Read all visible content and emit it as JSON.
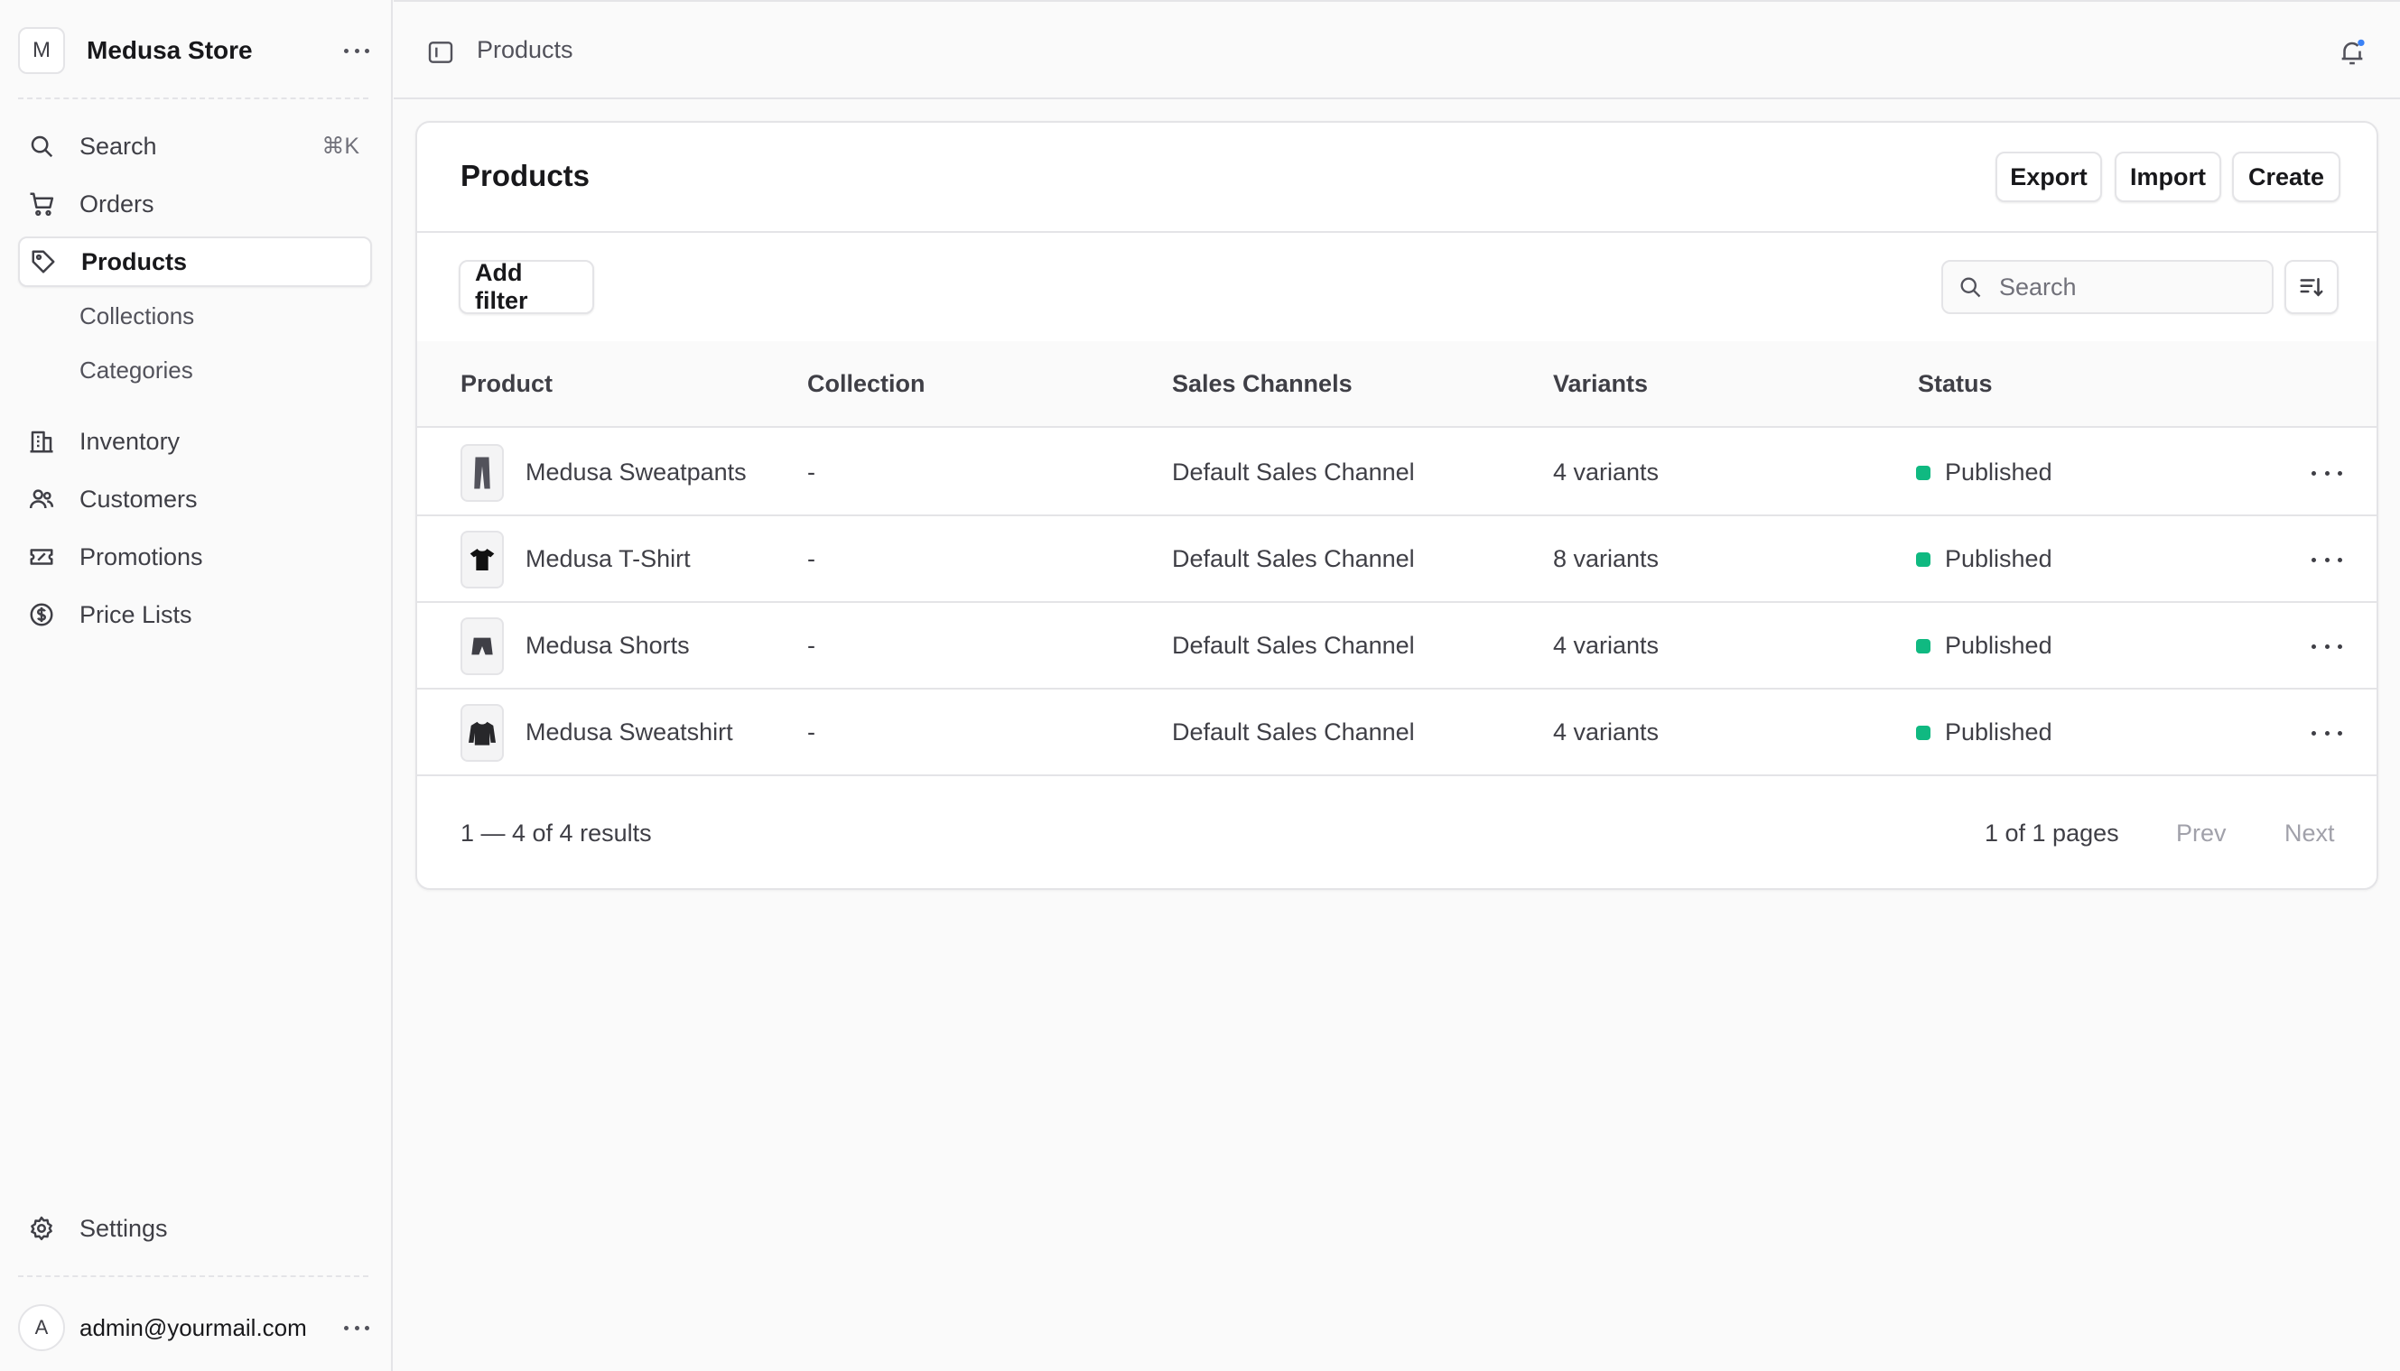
{
  "sidebar": {
    "store_initial": "M",
    "store_name": "Medusa Store",
    "search_label": "Search",
    "search_shortcut": "⌘K",
    "items": [
      {
        "label": "Orders",
        "icon": "cart-icon"
      },
      {
        "label": "Products",
        "icon": "tag-icon"
      },
      {
        "label": "Inventory",
        "icon": "building-icon"
      },
      {
        "label": "Customers",
        "icon": "users-icon"
      },
      {
        "label": "Promotions",
        "icon": "ticket-icon"
      },
      {
        "label": "Price Lists",
        "icon": "dollar-circle-icon"
      }
    ],
    "sub_items": [
      "Collections",
      "Categories"
    ],
    "settings_label": "Settings",
    "user_initial": "A",
    "user_email": "admin@yourmail.com"
  },
  "topbar": {
    "breadcrumb": "Products"
  },
  "main": {
    "title": "Products",
    "actions": {
      "export": "Export",
      "import": "Import",
      "create": "Create"
    },
    "add_filter": "Add filter",
    "search_placeholder": "Search",
    "columns": [
      "Product",
      "Collection",
      "Sales Channels",
      "Variants",
      "Status"
    ],
    "rows": [
      {
        "product": "Medusa Sweatpants",
        "collection": "-",
        "sales_channel": "Default Sales Channel",
        "variants": "4 variants",
        "status": "Published"
      },
      {
        "product": "Medusa T-Shirt",
        "collection": "-",
        "sales_channel": "Default Sales Channel",
        "variants": "8 variants",
        "status": "Published"
      },
      {
        "product": "Medusa Shorts",
        "collection": "-",
        "sales_channel": "Default Sales Channel",
        "variants": "4 variants",
        "status": "Published"
      },
      {
        "product": "Medusa Sweatshirt",
        "collection": "-",
        "sales_channel": "Default Sales Channel",
        "variants": "4 variants",
        "status": "Published"
      }
    ],
    "results": "1 — 4 of 4 results",
    "pages": "1 of 1 pages",
    "prev": "Prev",
    "next": "Next"
  },
  "colors": {
    "published": "#10b981",
    "notification": "#3b82f6"
  }
}
